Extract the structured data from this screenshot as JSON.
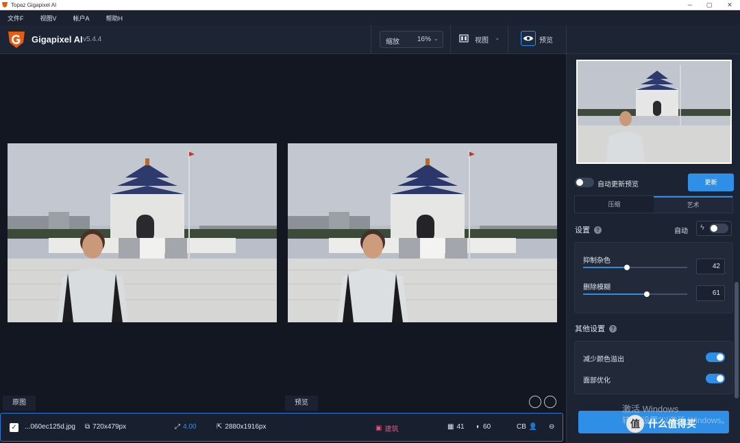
{
  "window": {
    "title": "Topaz Gigapixel AI",
    "controls": [
      "─",
      "▢",
      "✕"
    ]
  },
  "menu": [
    "文件F",
    "视图V",
    "帐户A",
    "帮助H"
  ],
  "header": {
    "brand": "Gigapixel AI",
    "version": "v5.4.4",
    "zoom_label": "缩放",
    "zoom_value": "16%",
    "view_label": "视图",
    "preview_label": "预览"
  },
  "panes": {
    "original_label": "原图",
    "preview_label": "预览"
  },
  "filebar": {
    "filename": "...060ec125d.jpg",
    "input_size": "720x479px",
    "scale": "4.00",
    "output_size": "2880x1916px",
    "model": "建筑",
    "stat1": "41",
    "stat2": "60",
    "cb": "CB"
  },
  "sidebar": {
    "auto_preview_label": "自动更新预览",
    "update_button": "更新",
    "tabs": [
      {
        "label": "压缩",
        "active": false
      },
      {
        "label": "艺术",
        "active": true
      }
    ],
    "settings_title": "设置",
    "auto_label": "自动",
    "sliders": [
      {
        "label": "抑制杂色",
        "value": 42,
        "max": 100
      },
      {
        "label": "删除模糊",
        "value": 61,
        "max": 100
      }
    ],
    "other_settings_title": "其他设置",
    "options": [
      {
        "label": "减少颜色溢出",
        "on": true
      },
      {
        "label": "面部优化",
        "on": true
      }
    ]
  },
  "overlay": {
    "watermark_line1": "激活 Windows",
    "watermark_line2": "转到\"设置\"以激活 Windows。",
    "site_name": "什么值得买",
    "site_icon": "值"
  },
  "colors": {
    "accent": "#2f8fe6",
    "background": "#131722",
    "panel": "#1c2333"
  }
}
